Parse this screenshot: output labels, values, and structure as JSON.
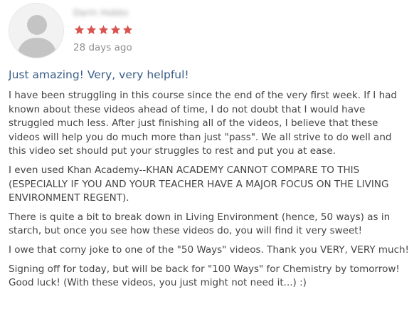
{
  "review": {
    "reviewer_name": "Darin Hobbs",
    "rating": 5,
    "rating_max": 5,
    "date": "28 days ago",
    "title": "Just amazing! Very, very helpful!",
    "paragraphs": [
      "I have been struggling in this course since the end of the very first week. If I had known about these videos ahead of time, I do not doubt that I would have struggled much less. After just finishing all of the videos, I believe that these videos will help you do much more than just \"pass\". We all strive to do well and this video set should put your struggles to rest and put you at ease.",
      "I even used Khan Academy--KHAN ACADEMY CANNOT COMPARE TO THIS (ESPECIALLY IF YOU AND YOUR TEACHER HAVE A MAJOR FOCUS ON THE LIVING ENVIRONMENT REGENT).",
      "There is quite a bit to break down in Living Environment (hence, 50 ways) as in starch, but once you see how these videos do, you will find it very sweet!",
      "I owe that corny joke to one of the \"50 Ways\" videos. Thank you VERY, VERY much!",
      "Signing off for today, but will be back for \"100 Ways\" for Chemistry by tomorrow! Good luck! (With these videos, you just might not need it...) :)"
    ]
  },
  "colors": {
    "star": "#d9534f",
    "title": "#3a5d87",
    "body_text": "#444444",
    "meta_text": "#8f8f8f",
    "avatar_bg": "#f2f2f2",
    "avatar_silhouette": "#c4c4c4"
  },
  "icons": {
    "avatar": "default-user-silhouette-icon",
    "star": "star-filled-icon"
  }
}
